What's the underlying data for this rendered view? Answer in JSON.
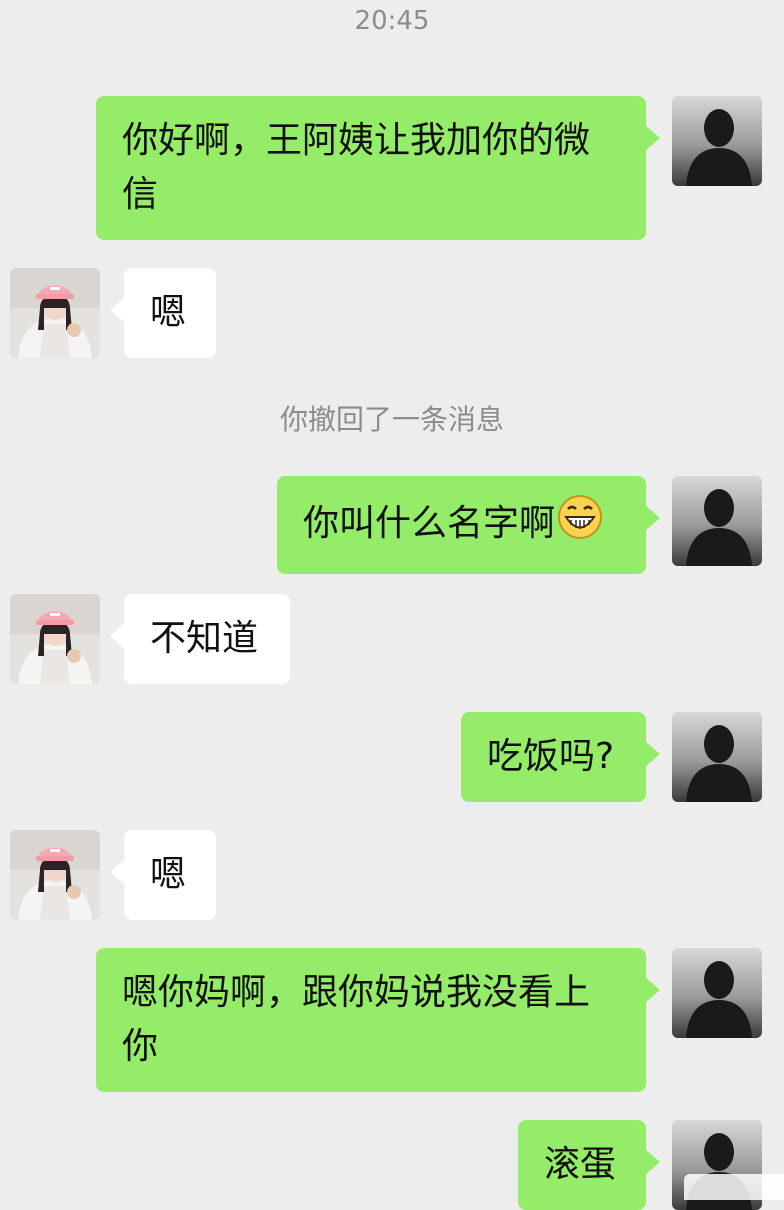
{
  "status": {
    "time": "20:45"
  },
  "messages": [
    {
      "side": "sent",
      "text": "你好啊，王阿姨让我加你的微信"
    },
    {
      "side": "recv",
      "text": "嗯"
    },
    {
      "side": "system",
      "text": "你撤回了一条消息"
    },
    {
      "side": "sent",
      "text": "你叫什么名字啊",
      "emoji": "grin-emoji"
    },
    {
      "side": "recv",
      "text": "不知道"
    },
    {
      "side": "sent",
      "text": "吃饭吗?"
    },
    {
      "side": "recv",
      "text": "嗯"
    },
    {
      "side": "sent",
      "text": "嗯你妈啊，跟你妈说我没看上你"
    },
    {
      "side": "sent",
      "text": "滚蛋"
    }
  ],
  "colors": {
    "background": "#ededed",
    "sent_bubble": "#95ec69",
    "recv_bubble": "#ffffff",
    "muted_text": "#8c8c8c"
  }
}
